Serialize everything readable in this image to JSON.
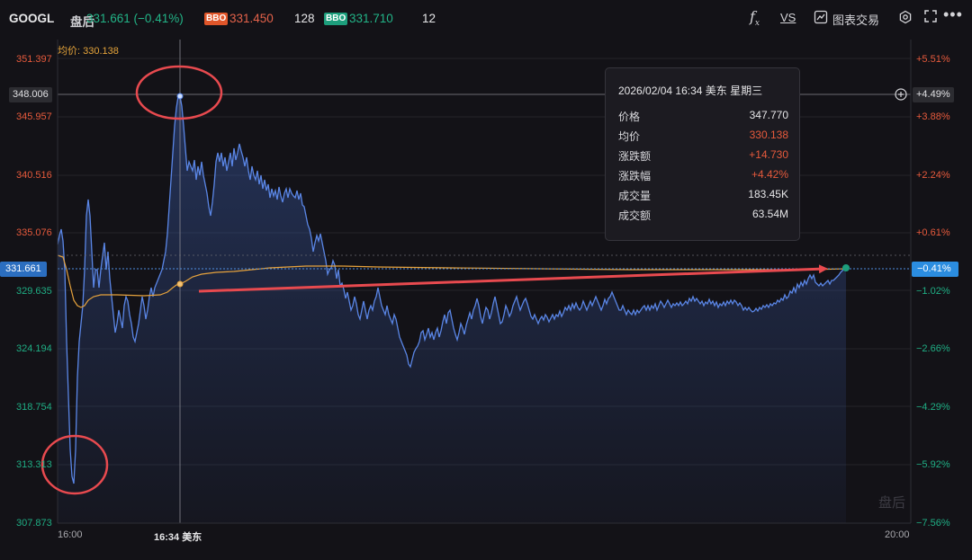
{
  "header": {
    "symbol": "GOOGL",
    "session": "盘后",
    "price_change": "331.661 (−0.41%)",
    "bbo_tag": "BBO",
    "bid_price": "331.450",
    "bid_size": "128",
    "ask_price": "331.710",
    "ask_size": "12",
    "vs_label": "VS",
    "trade_label": "图表交易",
    "more_label": "•••"
  },
  "chart": {
    "avg_legend": "均价: 330.138",
    "left_axis": [
      {
        "label": "351.397",
        "tone": "up"
      },
      {
        "label": "345.957",
        "tone": "up"
      },
      {
        "label": "340.516",
        "tone": "up"
      },
      {
        "label": "335.076",
        "tone": "up"
      },
      {
        "label": "329.635",
        "tone": "dn"
      },
      {
        "label": "324.194",
        "tone": "dn"
      },
      {
        "label": "318.754",
        "tone": "dn"
      },
      {
        "label": "313.313",
        "tone": "dn"
      },
      {
        "label": "307.873",
        "tone": "dn"
      }
    ],
    "right_axis": [
      {
        "label": "+5.51%",
        "tone": "up"
      },
      {
        "label": "+3.88%",
        "tone": "up"
      },
      {
        "label": "+2.24%",
        "tone": "up"
      },
      {
        "label": "+0.61%",
        "tone": "up"
      },
      {
        "label": "−1.02%",
        "tone": "dn"
      },
      {
        "label": "−2.66%",
        "tone": "dn"
      },
      {
        "label": "−4.29%",
        "tone": "dn"
      },
      {
        "label": "−5.92%",
        "tone": "dn"
      },
      {
        "label": "−7.56%",
        "tone": "dn"
      }
    ],
    "hover_price": "348.006",
    "hover_pct": "+4.49%",
    "current_price": "331.661",
    "current_pct": "−0.41%",
    "x_labels": {
      "start": "16:00",
      "hover": "16:34 美东",
      "end": "20:00"
    },
    "watermark": "盘后",
    "colors": {
      "line": "#5a86e6",
      "avg": "#e6a23c",
      "up": "#e75a3c",
      "down": "#1fae84",
      "accent": "#2b8de0",
      "annotation": "#e84a4f"
    }
  },
  "tooltip": {
    "title": "2026/02/04 16:34 美东 星期三",
    "rows": [
      {
        "k": "价格",
        "v": "347.770",
        "tone": "neutral"
      },
      {
        "k": "均价",
        "v": "330.138",
        "tone": "up"
      },
      {
        "k": "涨跌额",
        "v": "+14.730",
        "tone": "up"
      },
      {
        "k": "涨跌幅",
        "v": "+4.42%",
        "tone": "up"
      },
      {
        "k": "成交量",
        "v": "183.45K",
        "tone": "neutral"
      },
      {
        "k": "成交额",
        "v": "63.54M",
        "tone": "neutral"
      }
    ]
  }
}
